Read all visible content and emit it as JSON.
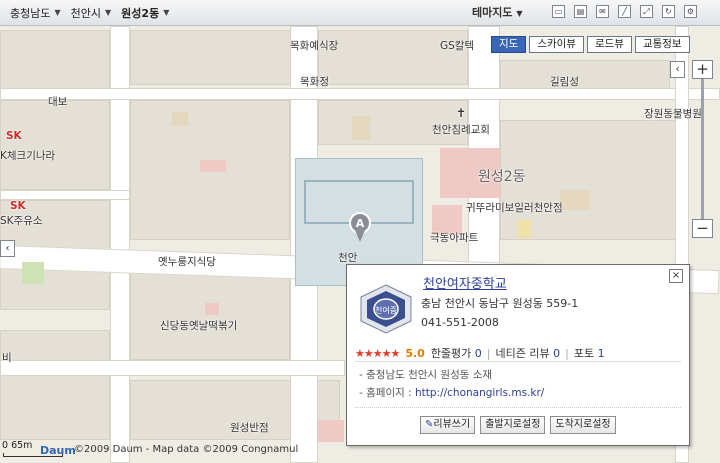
{
  "breadcrumb": [
    {
      "label": "충청남도"
    },
    {
      "label": "천안시"
    },
    {
      "label": "원성2동"
    }
  ],
  "theme_menu": {
    "label": "테마지도"
  },
  "map_types": [
    {
      "label": "지도",
      "active": true
    },
    {
      "label": "스카이뷰",
      "active": false
    },
    {
      "label": "로드뷰",
      "active": false
    },
    {
      "label": "교통정보",
      "active": false
    }
  ],
  "zoom": {
    "in": "+",
    "out": "−"
  },
  "map_labels": {
    "hwasu_market": "목화예식장",
    "gs": "GS칼텍",
    "mokhwa": "목화정",
    "gilrim": "길림성",
    "daebo": "대보",
    "cheonan_church": "천안침례교회",
    "wonseong_dong_mall": "장원동물병원",
    "sk_station_top": "SK",
    "sk_fuel_brand": "K체크기나라",
    "wonseong2dong": "원성2동",
    "sk_juyuso_brand": "SK",
    "sk_juyuso": "SK주유소",
    "apartment": "귀뚜라미보일러천안점",
    "gukdong_apt": "극동아파트",
    "yetnureung": "옛누룽지식당",
    "cheonan_marker_label": "천안",
    "sindang": "신당동옛날떡볶기",
    "bi": "비",
    "wonseong_shop": "원성반점"
  },
  "marker": {
    "letter": "A"
  },
  "info_window": {
    "title": "천안여자중학교",
    "address": "충남 천안시 동남구 원성동 559-1",
    "phone": "041-551-2008",
    "logo_text": "천여중",
    "stars": "★★★★★",
    "score": "5.0",
    "review_label": "한줄평가",
    "review_count": "0",
    "netizen_label": "네티즌 리뷰",
    "netizen_count": "0",
    "photo_label": "포토",
    "photo_count": "1",
    "desc": "- 충청남도 천안시 원성동 소재",
    "homepage_label": "- 홈페이지 : ",
    "homepage_url": "http://chonangirls.ms.kr/",
    "buttons": [
      "리뷰쓰기",
      "출발지로설정",
      "도착지로설정"
    ],
    "close": "×"
  },
  "footer": {
    "scale_label": "0      65m",
    "logo": "Daum",
    "copyright": "©2009 Daum - Map data ©2009 Congnamul"
  }
}
